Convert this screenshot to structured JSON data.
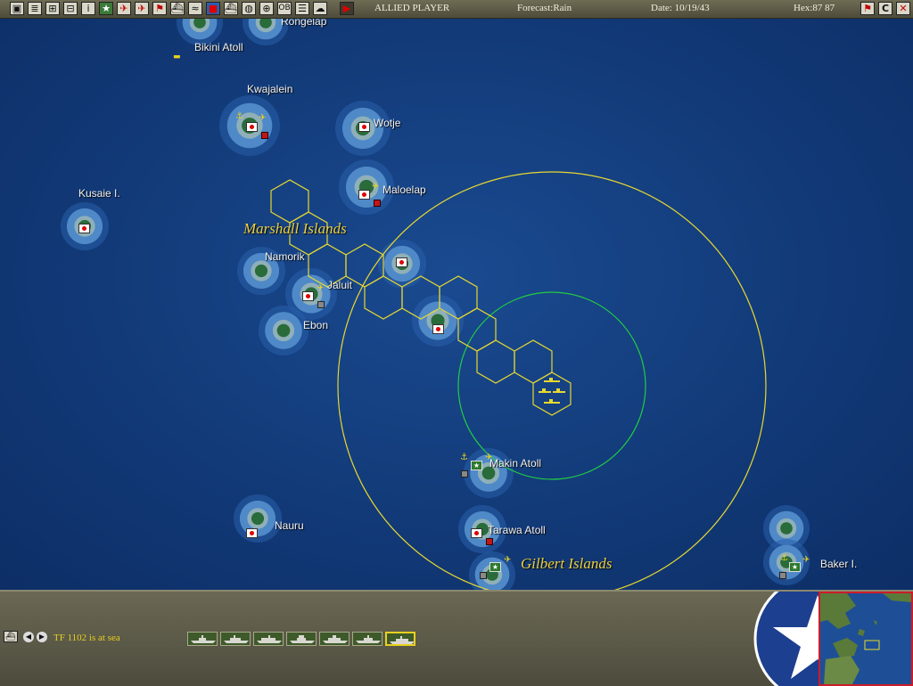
{
  "toolbar": {
    "player": "ALLIED PLAYER",
    "forecast": "Forecast:Rain",
    "date": "Date: 10/19/43",
    "hex": "Hex:87 87",
    "buttons_left": [
      "save-icon",
      "report-icon",
      "group-icon",
      "tf-icon",
      "info-icon",
      "star-icon",
      "air-icon",
      "plane-icon",
      "flag-icon",
      "ship-icon",
      "route-icon",
      "color-icon",
      "base-icon",
      "globe-icon",
      "center-icon",
      "ob-icon",
      "list-icon",
      "weather-icon",
      "end-turn-icon"
    ],
    "buttons_right": [
      "jp-flag-icon",
      "c-icon",
      "exit-icon"
    ],
    "ob_label": "OB",
    "c_label": "C"
  },
  "map": {
    "locations": [
      {
        "name": "Rongelap"
      },
      {
        "name": "Bikini Atoll"
      },
      {
        "name": "Kwajalein"
      },
      {
        "name": "Wotje"
      },
      {
        "name": "Maloelap"
      },
      {
        "name": "Kusaie I."
      },
      {
        "name": "Namorik"
      },
      {
        "name": "Jaluit"
      },
      {
        "name": "Ebon"
      },
      {
        "name": "Makin Atoll"
      },
      {
        "name": "Nauru"
      },
      {
        "name": "Tarawa Atoll"
      },
      {
        "name": "Baker I."
      }
    ],
    "regions": [
      "Marshall Islands",
      "Gilbert Islands"
    ],
    "colors": {
      "sea": "#123a78",
      "hex_path": "#e6d830",
      "range_outer": "#e6d830",
      "range_inner": "#22cc44",
      "japan_red": "#d00000",
      "allied_green": "#2d7a2d"
    }
  },
  "bottom": {
    "status": "TF 1102 is at sea",
    "ships_selected_index": 6,
    "ship_count": 7
  }
}
